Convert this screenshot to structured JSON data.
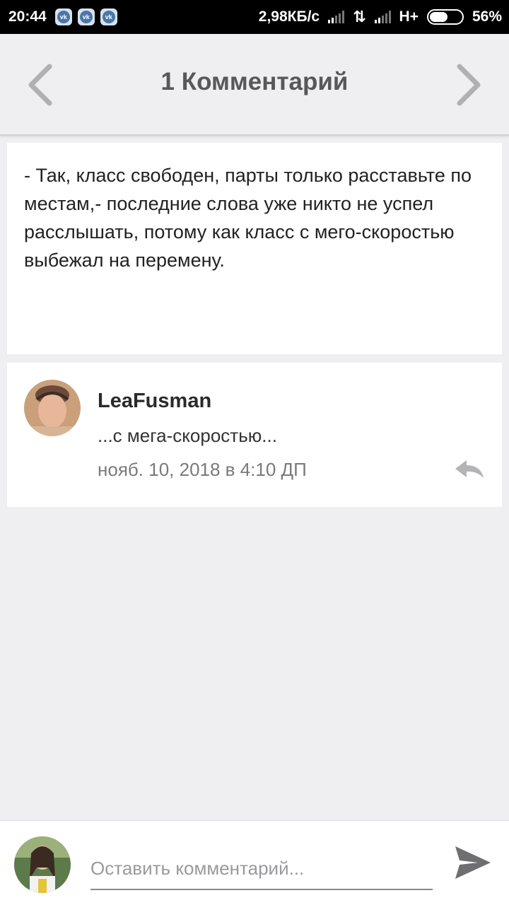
{
  "status_bar": {
    "time": "20:44",
    "notification_icons": [
      "vk-icon",
      "vk-icon",
      "vk-icon"
    ],
    "network_speed": "2,98КБ/с",
    "network_type": "H+",
    "battery_percent": "56%",
    "battery_level": 0.56
  },
  "header": {
    "title": "1 Комментарий",
    "prev_icon": "chevron-left-icon",
    "next_icon": "chevron-right-icon"
  },
  "post": {
    "text": "- Так, класс свободен, парты только расставьте по местам,- последние слова уже никто не успел расслышать, потому как класс с мего-скоростью выбежал на перемену."
  },
  "comments": [
    {
      "author": "LeaFusman",
      "text": "...с мега-скоростью...",
      "date": "нояб. 10, 2018 в 4:10 ДП",
      "reply_icon": "reply-icon"
    }
  ],
  "compose": {
    "placeholder": "Оставить комментарий...",
    "value": "",
    "send_icon": "send-icon"
  },
  "colors": {
    "background": "#efeef0",
    "card": "#ffffff",
    "title_text": "#58575a",
    "arrow_gray": "#b0afb2"
  }
}
